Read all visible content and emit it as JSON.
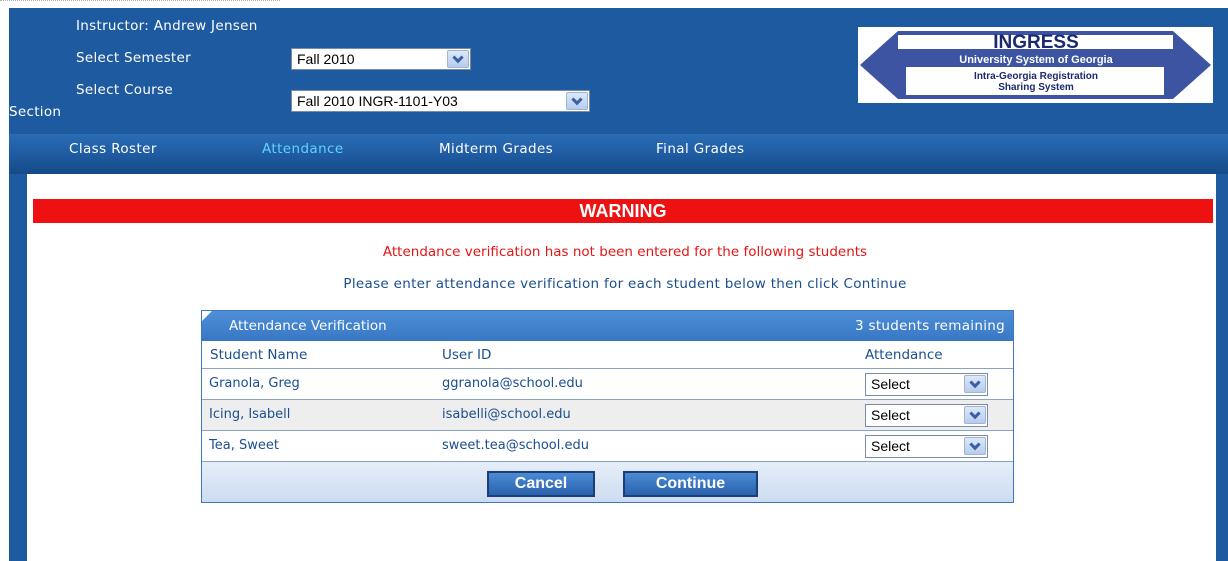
{
  "header": {
    "instructor_label": "Instructor: Andrew Jensen",
    "semester_label": "Select Semester",
    "semester_value": "Fall 2010",
    "course_label_line1": "Select Course",
    "course_label_line2": "Section",
    "course_value": "Fall 2010 INGR-1101-Y03"
  },
  "logo": {
    "title": "INGRESS",
    "line1": "University System of Georgia",
    "line2": "Intra-Georgia Registration",
    "line3": "Sharing System"
  },
  "nav": {
    "items": [
      "Class Roster",
      "Attendance",
      "Midterm Grades",
      "Final Grades"
    ],
    "active": "Attendance"
  },
  "warning": {
    "title": "WARNING",
    "message": "Attendance verification has not been entered for the following students",
    "instruction": "Please enter attendance verification for each student below then click Continue"
  },
  "table": {
    "title": "Attendance Verification",
    "remaining": "3 students remaining",
    "columns": [
      "Student Name",
      "User ID",
      "Attendance"
    ],
    "rows": [
      {
        "name": "Granola, Greg",
        "user_id": "ggranola@school.edu",
        "attendance": "Select"
      },
      {
        "name": "Icing, Isabell",
        "user_id": "isabelli@school.edu",
        "attendance": "Select"
      },
      {
        "name": "Tea, Sweet",
        "user_id": "sweet.tea@school.edu",
        "attendance": "Select"
      }
    ],
    "cancel_label": "Cancel",
    "continue_label": "Continue"
  },
  "colors": {
    "header_blue": "#1e5aa0",
    "active_nav": "#5fd3ff",
    "warning_red": "#ee1111",
    "message_red": "#e41515",
    "text_blue": "#1a4f8f"
  }
}
